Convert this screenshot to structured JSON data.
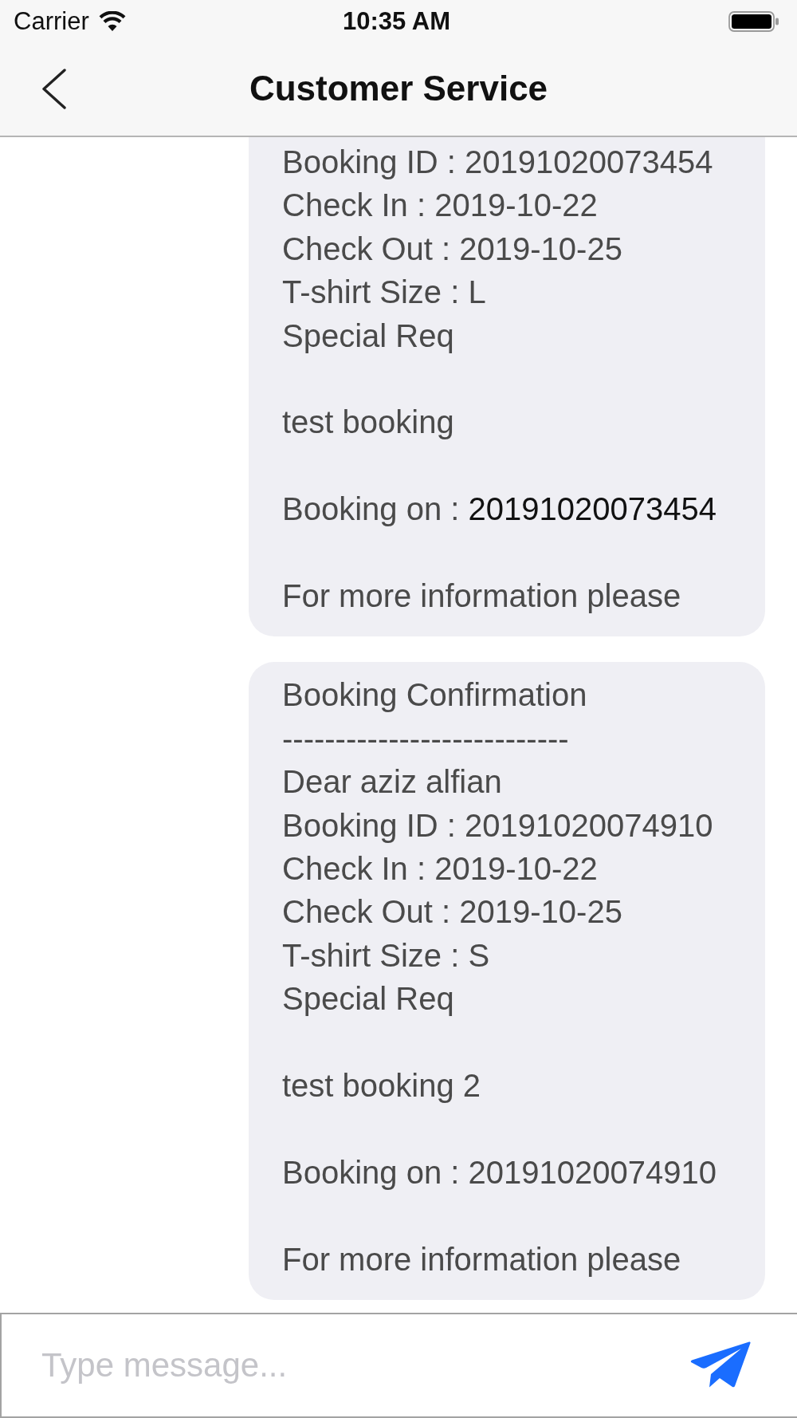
{
  "status_bar": {
    "carrier": "Carrier",
    "time": "10:35 AM"
  },
  "nav_bar": {
    "title": "Customer Service"
  },
  "messages": [
    {
      "lines": [
        {
          "kind": "text",
          "text": "Booking ID : 20191020073454"
        },
        {
          "kind": "text",
          "text": "Check In : 2019-10-22"
        },
        {
          "kind": "text",
          "text": "Check Out : 2019-10-25"
        },
        {
          "kind": "text",
          "text": "T-shirt Size : L"
        },
        {
          "kind": "text",
          "text": "Special Req"
        },
        {
          "kind": "blank"
        },
        {
          "kind": "text",
          "text": "test booking"
        },
        {
          "kind": "blank"
        },
        {
          "kind": "text",
          "text": "Booking on : ",
          "link": "20191020073454"
        },
        {
          "kind": "blank"
        },
        {
          "kind": "text",
          "text": "For more information please"
        }
      ]
    },
    {
      "lines": [
        {
          "kind": "text",
          "text": "Booking Confirmation"
        },
        {
          "kind": "text",
          "text": "---------------------------"
        },
        {
          "kind": "text",
          "text": "Dear aziz alfian"
        },
        {
          "kind": "text",
          "text": "Booking ID : 20191020074910"
        },
        {
          "kind": "text",
          "text": "Check In : 2019-10-22"
        },
        {
          "kind": "text",
          "text": "Check Out : 2019-10-25"
        },
        {
          "kind": "text",
          "text": "T-shirt Size : S"
        },
        {
          "kind": "text",
          "text": "Special Req"
        },
        {
          "kind": "blank"
        },
        {
          "kind": "text",
          "text": "test booking 2"
        },
        {
          "kind": "blank"
        },
        {
          "kind": "text",
          "text": "Booking on : 20191020074910"
        },
        {
          "kind": "blank"
        },
        {
          "kind": "text",
          "text": "For more information please"
        }
      ]
    }
  ],
  "composer": {
    "placeholder": "Type message..."
  }
}
